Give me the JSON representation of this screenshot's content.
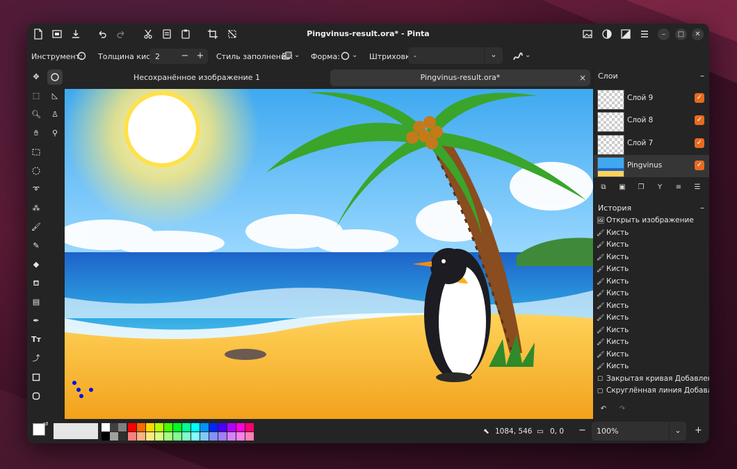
{
  "window": {
    "title": "Pingvinus-result.ora* - Pinta"
  },
  "toolbar": {
    "tool_label": "Инструмент:",
    "brush_width_label": "Толщина кисти:",
    "brush_width_value": "2",
    "minus": "−",
    "plus": "+",
    "fill_style_label": "Стиль заполнения:",
    "shape_label": "Форма:",
    "hatch_label": "Штриховка:",
    "hatch_value": "-"
  },
  "tabs": [
    {
      "label": "Несохранённое изображение 1",
      "active": false
    },
    {
      "label": "Pingvinus-result.ora*",
      "active": true,
      "close": "×"
    }
  ],
  "layers_panel": {
    "title": "Слои",
    "collapse": "–",
    "layers": [
      {
        "name": "Слой 9",
        "visible": true
      },
      {
        "name": "Слой 8",
        "visible": true
      },
      {
        "name": "Слой 7",
        "visible": true
      },
      {
        "name": "Pingvinus",
        "visible": true,
        "selected": true
      }
    ],
    "check_mark": "✓"
  },
  "history_panel": {
    "title": "История",
    "collapse": "–",
    "items": [
      {
        "icon": "open-image-icon",
        "label": "Открыть изображение"
      },
      {
        "icon": "brush-icon",
        "label": "Кисть"
      },
      {
        "icon": "brush-icon",
        "label": "Кисть"
      },
      {
        "icon": "brush-icon",
        "label": "Кисть"
      },
      {
        "icon": "brush-icon",
        "label": "Кисть"
      },
      {
        "icon": "brush-icon",
        "label": "Кисть"
      },
      {
        "icon": "brush-icon",
        "label": "Кисть"
      },
      {
        "icon": "brush-icon",
        "label": "Кисть"
      },
      {
        "icon": "brush-icon",
        "label": "Кисть"
      },
      {
        "icon": "brush-icon",
        "label": "Кисть"
      },
      {
        "icon": "brush-icon",
        "label": "Кисть"
      },
      {
        "icon": "brush-icon",
        "label": "Кисть"
      },
      {
        "icon": "brush-icon",
        "label": "Кисть"
      },
      {
        "icon": "rectangle-icon",
        "label": "Закрытая кривая Добавлено"
      },
      {
        "icon": "rounded-rectangle-icon",
        "label": "Скруглённая линия Добавлено"
      }
    ]
  },
  "status": {
    "cursor_position": "1084, 546",
    "selection_size": "0, 0",
    "zoom": "100%",
    "zoom_out": "−",
    "zoom_in": "+"
  },
  "palette": {
    "row1": [
      "#ff0000",
      "#ff6a00",
      "#ffd800",
      "#b6ff00",
      "#4cff00",
      "#00ff21",
      "#00ff90",
      "#00ffff",
      "#0094ff",
      "#0026ff",
      "#4800ff",
      "#b200ff",
      "#ff00dc",
      "#ff006e"
    ],
    "row2": [
      "#ff7f7f",
      "#ffb27f",
      "#ffe97f",
      "#daff7f",
      "#a5ff7f",
      "#7fff8e",
      "#7fffc5",
      "#7fffff",
      "#7fc9ff",
      "#7f92ff",
      "#a17fff",
      "#d67fff",
      "#ff7fed",
      "#ff7fb6"
    ],
    "grays_top": [
      "#ffffff",
      "#404040",
      "#808080"
    ],
    "grays_bottom": [
      "#000000",
      "#a0a0a0",
      "#303030"
    ]
  },
  "colors": {
    "accent": "#e66b1f",
    "window_bg": "#242424",
    "primary_color": "#ffffff",
    "secondary_color": "#000000"
  }
}
